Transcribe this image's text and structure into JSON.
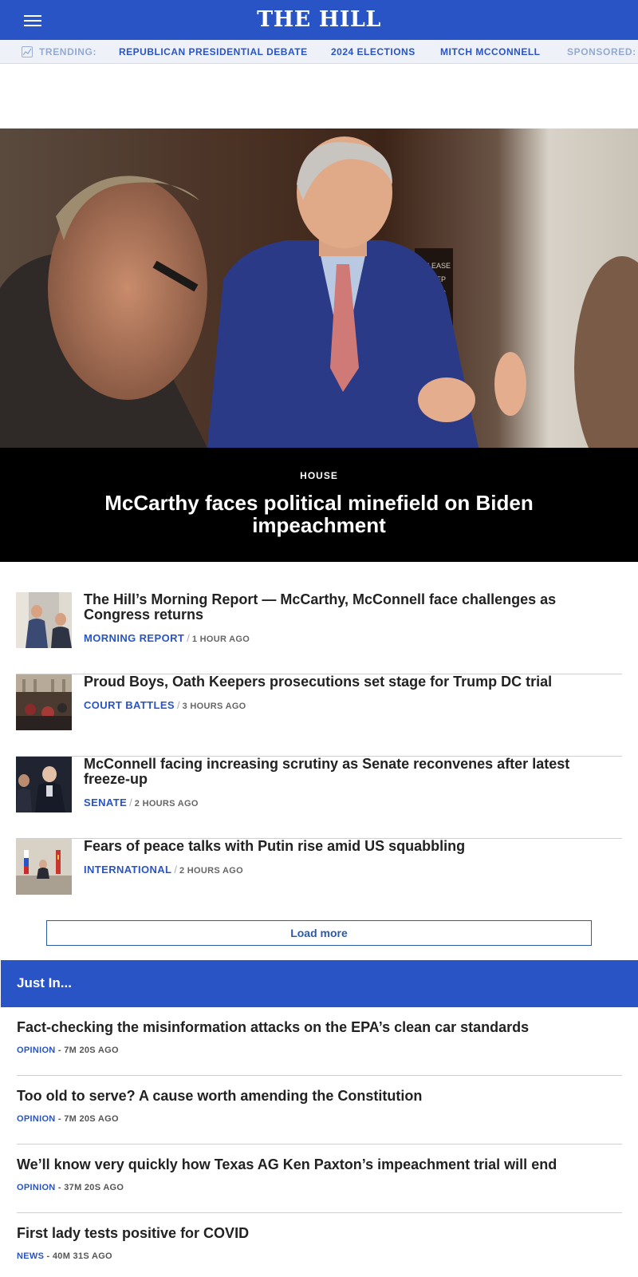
{
  "header": {
    "logo": "THE HILL",
    "brand_color": "#2854c5"
  },
  "trending": {
    "label": "TRENDING:",
    "items": [
      "REPUBLICAN PRESIDENTIAL DEBATE",
      "2024 ELECTIONS",
      "MITCH MCCONNELL"
    ],
    "sponsored": "SPONSORED:"
  },
  "hero": {
    "section": "HOUSE",
    "title": "McCarthy faces political minefield on Biden impeachment"
  },
  "articles": [
    {
      "title": "The Hill’s Morning Report — McCarthy, McConnell face challenges as Congress returns",
      "category": "MORNING REPORT",
      "separator": "/",
      "time": "1 HOUR AGO"
    },
    {
      "title": "Proud Boys, Oath Keepers prosecutions set stage for Trump DC trial",
      "category": "COURT BATTLES",
      "separator": "/",
      "time": "3 HOURS AGO"
    },
    {
      "title": "McConnell facing increasing scrutiny as Senate reconvenes after latest freeze-up",
      "category": "SENATE",
      "separator": "/",
      "time": "2 HOURS AGO"
    },
    {
      "title": "Fears of peace talks with Putin rise amid US squabbling",
      "category": "INTERNATIONAL",
      "separator": "/",
      "time": "2 HOURS AGO"
    }
  ],
  "load_more": "Load more",
  "just_in": {
    "title": "Just In...",
    "items": [
      {
        "title": "Fact-checking the misinformation attacks on the EPA’s clean car standards",
        "category": "OPINION",
        "time": " - 7M 20S AGO"
      },
      {
        "title": "Too old to serve? A cause worth amending the Constitution",
        "category": "OPINION",
        "time": " - 7M 20S AGO"
      },
      {
        "title": "We’ll know very quickly how Texas AG Ken Paxton’s impeachment trial will end",
        "category": "OPINION",
        "time": " - 37M 20S AGO"
      },
      {
        "title": "First lady tests positive for COVID",
        "category": "NEWS",
        "time": " - 40M 31S AGO"
      }
    ]
  }
}
